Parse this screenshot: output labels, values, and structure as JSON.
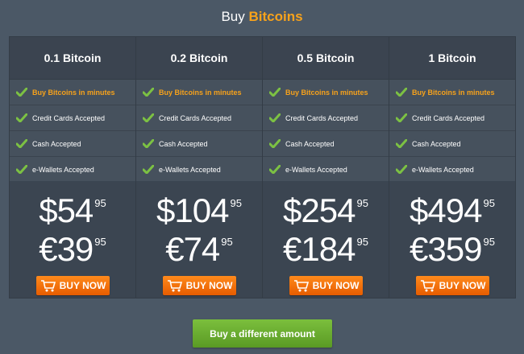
{
  "header": {
    "title_prefix": "Buy",
    "title_accent": "Bitcoins"
  },
  "colors": {
    "accent": "#f7a21b",
    "buy_button": "#f47b10",
    "cta_button": "#6aae2e",
    "check": "#7cc143"
  },
  "plans": [
    {
      "name": "0.1 Bitcoin",
      "features": [
        "Buy Bitcoins in minutes",
        "Credit Cards Accepted",
        "Cash Accepted",
        "e-Wallets Accepted"
      ],
      "usd": "$54",
      "usd_cents": "95",
      "eur": "€39",
      "eur_cents": "95",
      "buy_label": "BUY NOW"
    },
    {
      "name": "0.2 Bitcoin",
      "features": [
        "Buy Bitcoins in minutes",
        "Credit Cards Accepted",
        "Cash Accepted",
        "e-Wallets Accepted"
      ],
      "usd": "$104",
      "usd_cents": "95",
      "eur": "€74",
      "eur_cents": "95",
      "buy_label": "BUY NOW"
    },
    {
      "name": "0.5 Bitcoin",
      "features": [
        "Buy Bitcoins in minutes",
        "Credit Cards Accepted",
        "Cash Accepted",
        "e-Wallets Accepted"
      ],
      "usd": "$254",
      "usd_cents": "95",
      "eur": "€184",
      "eur_cents": "95",
      "buy_label": "BUY NOW"
    },
    {
      "name": "1 Bitcoin",
      "features": [
        "Buy Bitcoins in minutes",
        "Credit Cards Accepted",
        "Cash Accepted",
        "e-Wallets Accepted"
      ],
      "usd": "$494",
      "usd_cents": "95",
      "eur": "€359",
      "eur_cents": "95",
      "buy_label": "BUY NOW"
    }
  ],
  "footer": {
    "different_amount_label": "Buy a different amount"
  },
  "icons": {
    "feature_check": "check-icon",
    "buy": "shopping-cart-icon"
  }
}
